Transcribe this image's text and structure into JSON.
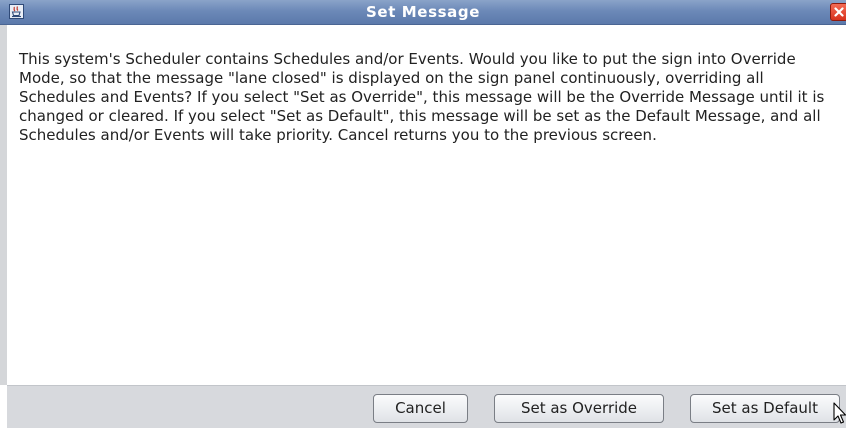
{
  "window": {
    "title": "Set Message",
    "icon": "java-icon",
    "close_icon": "close-icon"
  },
  "message": {
    "text": "This system's Scheduler contains Schedules and/or Events. Would you like to put the sign into Override Mode, so that the message \"lane closed\" is displayed on the sign panel continuously, overriding all Schedules and Events? If you select \"Set as Override\", this message will be the Override Message until it is changed or cleared. If you select \"Set as Default\", this message will be set as the Default Message, and all Schedules and/or Events will take priority. Cancel returns you to the previous screen."
  },
  "buttons": {
    "cancel": "Cancel",
    "override": "Set as Override",
    "default": "Set as Default"
  },
  "colors": {
    "titlebar": "#6c89b8",
    "close": "#d8321d",
    "button_bar": "#d7d9dd"
  }
}
